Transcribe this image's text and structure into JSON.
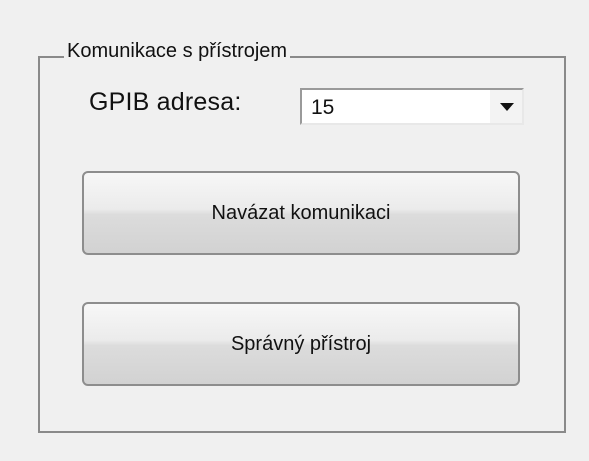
{
  "group": {
    "title": "Komunikace s přístrojem"
  },
  "gpib": {
    "label": "GPIB adresa:",
    "selected_value": "15",
    "dropdown_icon": "chevron-down-icon"
  },
  "buttons": {
    "connect_label": "Navázat komunikaci",
    "correct_device_label": "Správný přístroj"
  }
}
